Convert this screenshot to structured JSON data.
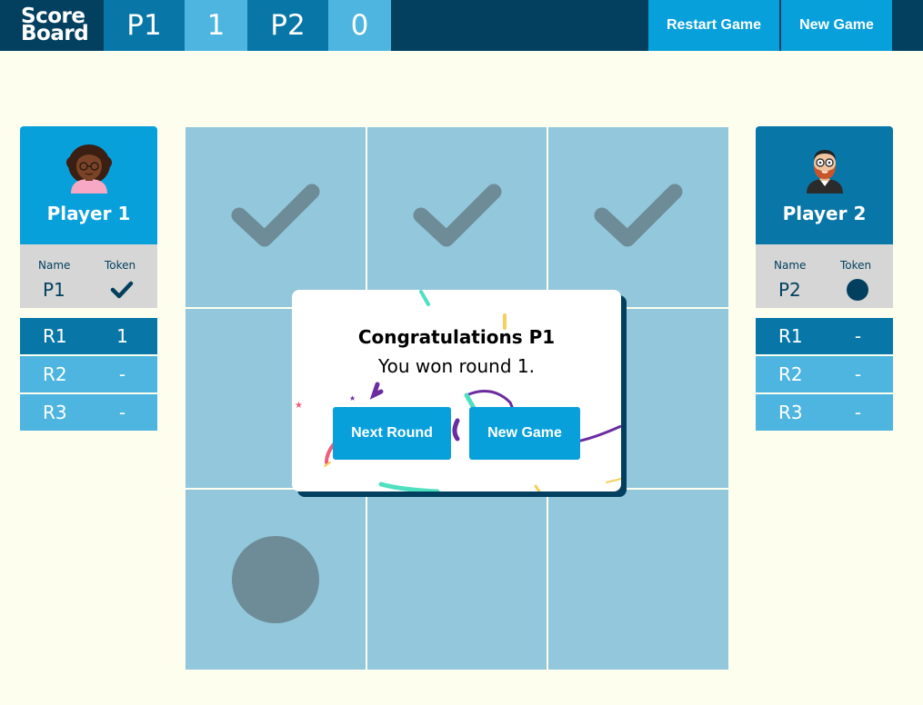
{
  "header": {
    "logo_line1": "Score",
    "logo_line2": "Board",
    "p1_label": "P1",
    "p1_score": "1",
    "p2_label": "P2",
    "p2_score": "0",
    "restart_label": "Restart Game",
    "new_game_label": "New Game"
  },
  "players": [
    {
      "title": "Player 1",
      "name_header": "Name",
      "token_header": "Token",
      "name": "P1",
      "token_icon": "checkmark-icon",
      "rounds": [
        {
          "label": "R1",
          "value": "1"
        },
        {
          "label": "R2",
          "value": "-"
        },
        {
          "label": "R3",
          "value": "-"
        }
      ]
    },
    {
      "title": "Player 2",
      "name_header": "Name",
      "token_header": "Token",
      "name": "P2",
      "token_icon": "circle-icon",
      "rounds": [
        {
          "label": "R1",
          "value": "-"
        },
        {
          "label": "R2",
          "value": "-"
        },
        {
          "label": "R3",
          "value": "-"
        }
      ]
    }
  ],
  "board": {
    "cells": [
      "check",
      "check",
      "check",
      "",
      "",
      "",
      "circle",
      "",
      ""
    ]
  },
  "modal": {
    "title": "Congratulations P1",
    "message": "You won round 1.",
    "next_round_label": "Next Round",
    "new_game_label": "New Game"
  },
  "colors": {
    "background": "#fefeee",
    "navy": "#03405f",
    "blue_dark": "#0877a8",
    "blue_mid": "#08a0db",
    "blue_light": "#4db5e0",
    "board": "#92c7dc",
    "mark": "#6d8c98"
  }
}
